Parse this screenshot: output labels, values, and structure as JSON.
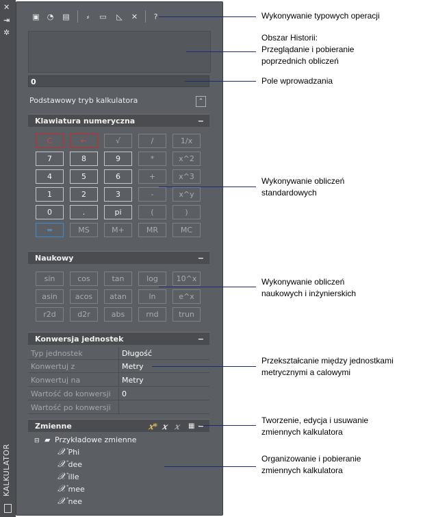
{
  "palette": {
    "title": "KALKULATOR"
  },
  "history": {
    "label": ""
  },
  "input": {
    "value": "0"
  },
  "mode": {
    "label": "Podstawowy tryb kalkulatora"
  },
  "numpad": {
    "title": "Klawiatura numeryczna",
    "collapse": "−",
    "rows": [
      [
        "C",
        "←",
        "√",
        "/",
        "1/x"
      ],
      [
        "7",
        "8",
        "9",
        "*",
        "x^2"
      ],
      [
        "4",
        "5",
        "6",
        "+",
        "x^3"
      ],
      [
        "1",
        "2",
        "3",
        "-",
        "x^y"
      ],
      [
        "0",
        ".",
        "pi",
        "(",
        ")"
      ],
      [
        "=",
        "MS",
        "M+",
        "MR",
        "MC"
      ]
    ]
  },
  "scientific": {
    "title": "Naukowy",
    "collapse": "−",
    "rows": [
      [
        "sin",
        "cos",
        "tan",
        "log",
        "10^x"
      ],
      [
        "asin",
        "acos",
        "atan",
        "ln",
        "e^x"
      ],
      [
        "r2d",
        "d2r",
        "abs",
        "rnd",
        "trun"
      ]
    ]
  },
  "units": {
    "title": "Konwersja jednostek",
    "collapse": "−",
    "rows": [
      {
        "key": "Typ jednostek",
        "value": "Długość"
      },
      {
        "key": "Konwertuj z",
        "value": "Metry"
      },
      {
        "key": "Konwertuj na",
        "value": "Metry"
      },
      {
        "key": "Wartość do konwersji",
        "value": "0"
      },
      {
        "key": "Wartość po konwersji",
        "value": ""
      }
    ]
  },
  "variables": {
    "title": "Zmienne",
    "collapse": "−",
    "folder": "Przykładowe zmienne",
    "items": [
      "Phi",
      "dee",
      "ille",
      "mee",
      "nee"
    ]
  },
  "callouts": [
    "Wykonywanie typowych operacji",
    "Obszar Historii:",
    "Przeglądanie i pobieranie",
    "poprzednich obliczeń",
    "Pole wprowadzania",
    "Wykonywanie obliczeń",
    "standardowych",
    "Wykonywanie obliczeń",
    "naukowych i inżynierskich",
    "Przekształcanie między jednostkami",
    "metrycznymi a calowymi",
    "Tworzenie, edycja i usuwanie",
    "zmiennych kalkulatora",
    "Organizowanie i pobieranie",
    "zmiennych kalkulatora"
  ]
}
